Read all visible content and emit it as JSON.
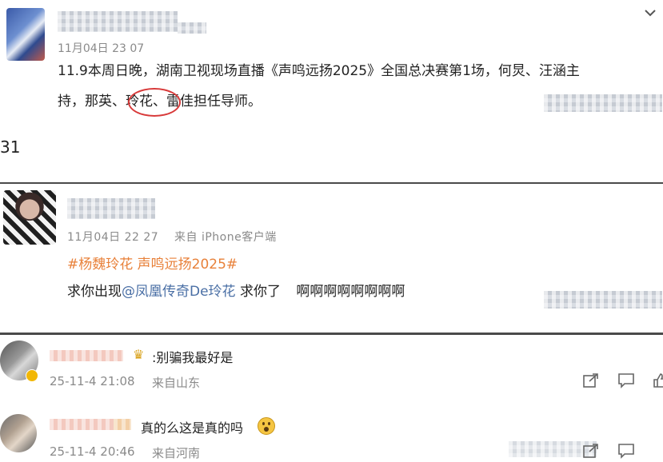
{
  "post": {
    "timestamp": "11月04日 23 07",
    "line1": "11.9本周日晚，湖南卫视现场直播《声鸣远扬2025》全国总决赛第1场，何炅、汪涵主",
    "line2_before": "持，那英、",
    "line2_highlight": "玲花、",
    "line2_after": "雷佳担任导师。"
  },
  "side_number": "31",
  "repost": {
    "timestamp": "11月04日 22 27",
    "source": "来自 iPhone客户端",
    "hashtags": "#杨魏玲花 声鸣远扬2025#",
    "text_before": "求你出现",
    "mention": "@凤凰传奇De玲花",
    "text_after": "求你了",
    "text_emph": "啊啊啊啊啊啊啊啊"
  },
  "comments": [
    {
      "text": ":别骗我最好是",
      "date": "25-11-4 21:08",
      "location": "来自山东"
    },
    {
      "text": "真的么这是真的吗",
      "date": "25-11-4 20:46",
      "location": "来自河南"
    }
  ],
  "icons": {
    "top_right": "chevron-down-icon",
    "share": "share-icon",
    "comment": "comment-icon",
    "like": "like-icon"
  },
  "colors": {
    "hashtag": "#e8813a",
    "mention": "#4a6fa5",
    "circle": "#d83a3a"
  }
}
